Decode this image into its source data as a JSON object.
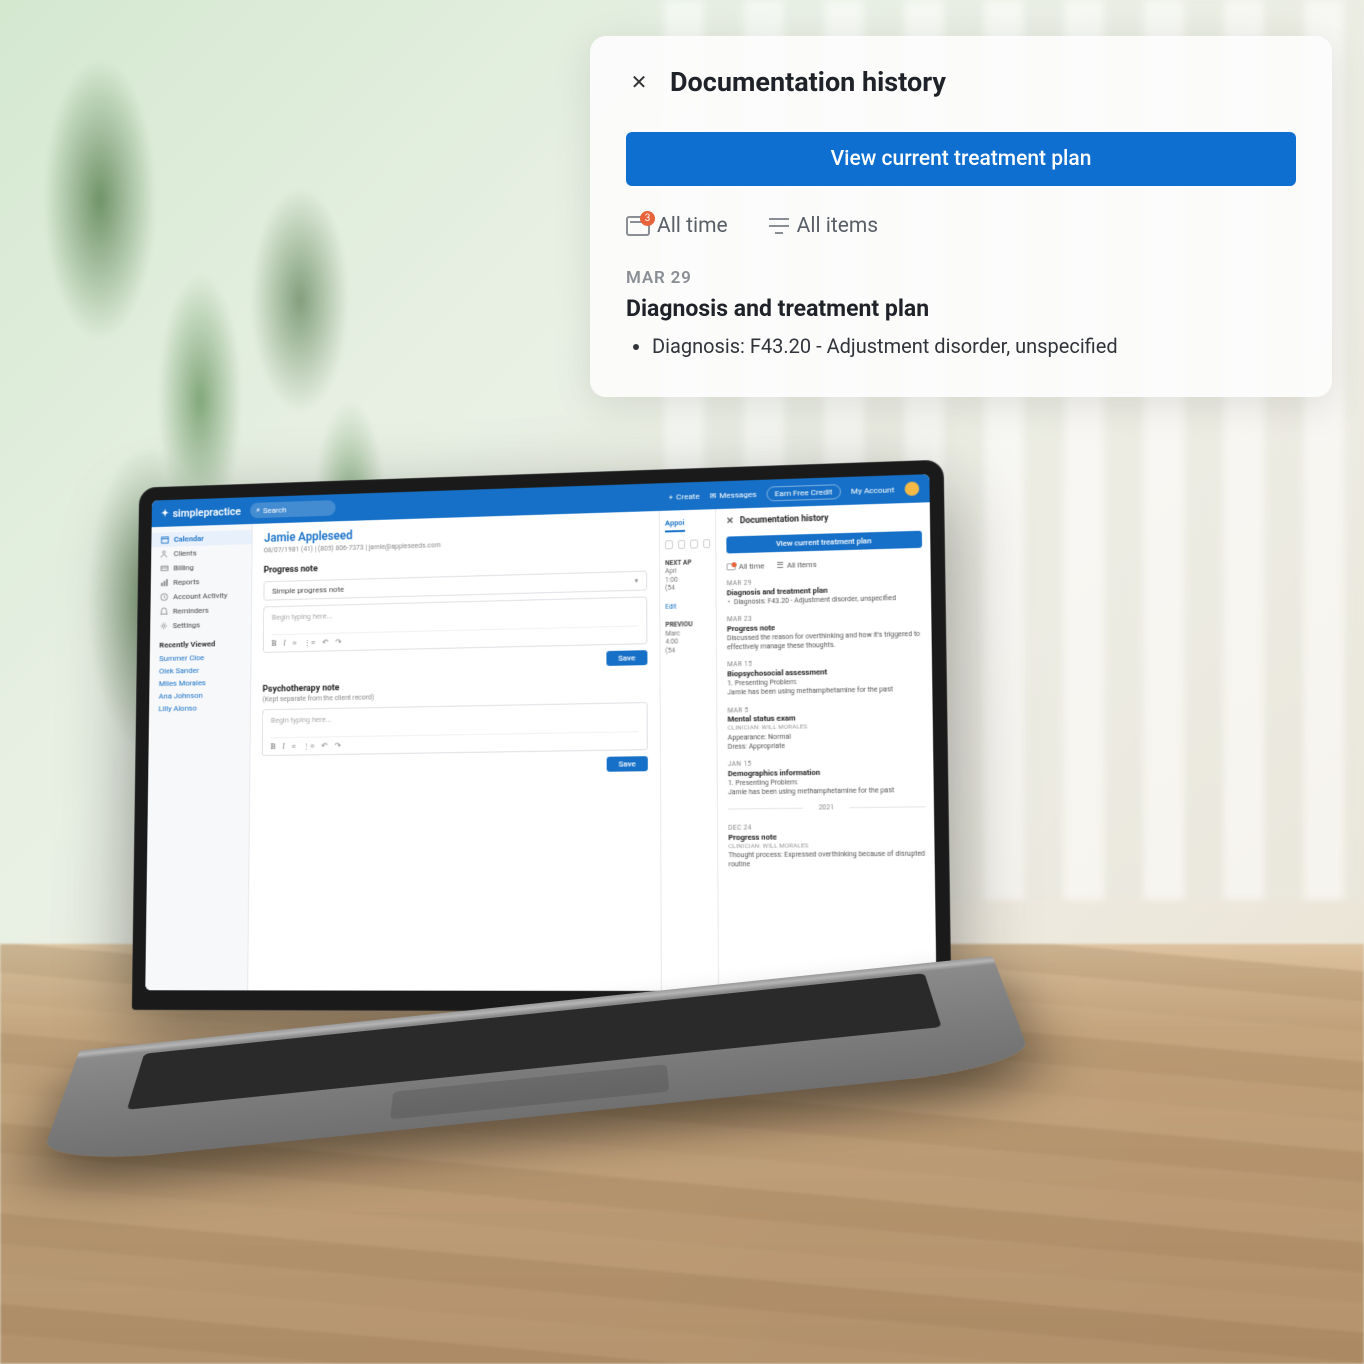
{
  "app": {
    "brand": "simplepractice",
    "search_placeholder": "Search",
    "create": "Create",
    "messages": "Messages",
    "earn_credit": "Earn Free Credit",
    "my_account": "My Account"
  },
  "sidebar": {
    "items": [
      {
        "label": "Calendar",
        "active": true
      },
      {
        "label": "Clients"
      },
      {
        "label": "Billing"
      },
      {
        "label": "Reports"
      },
      {
        "label": "Account Activity"
      },
      {
        "label": "Reminders"
      },
      {
        "label": "Settings"
      }
    ],
    "recent_heading": "Recently Viewed",
    "recent": [
      "Summer Cloe",
      "Olek Sander",
      "Miles Morales",
      "Ana Johnson",
      "Lilly Alonso"
    ]
  },
  "client": {
    "name": "Jamie Appleseed",
    "meta": "08/07/1981 (41) | (805) 806-7373 | jamie@appleseeds.com"
  },
  "progress_note": {
    "title": "Progress note",
    "template_select": "Simple progress note",
    "placeholder": "Begin typing here...",
    "save": "Save"
  },
  "psych_note": {
    "title": "Psychotherapy note",
    "subtitle": "(Kept separate from the client record)",
    "placeholder": "Begin typing here...",
    "save": "Save"
  },
  "strip": {
    "tab": "Appoi",
    "next": {
      "h": "NEXT AP",
      "l1": "Apri",
      "l2": "1:00",
      "l3": "(54"
    },
    "edit": "Edit",
    "prev": {
      "h": "PREVIOU",
      "l1": "Marc",
      "l2": "4:00",
      "l3": "(54"
    }
  },
  "dochistory": {
    "title": "Documentation history",
    "view_btn": "View current treatment plan",
    "filters": {
      "time": "All time",
      "items": "All items"
    },
    "entries": [
      {
        "date": "MAR 29",
        "title": "Diagnosis and treatment plan",
        "bullets": [
          "Diagnosis: F43.20 - Adjustment disorder, unspecified"
        ]
      },
      {
        "date": "MAR 23",
        "title": "Progress note",
        "body": "Discussed the reason for overthinking and how it's triggered to effectively manage these thoughts."
      },
      {
        "date": "MAR 15",
        "title": "Biopsychosocial assessment",
        "body": "1. Presenting Problem:\nJamie has been using methamphetamine for the past"
      },
      {
        "date": "MAR 5",
        "title": "Mental status exam",
        "clin": "CLINICIAN: WILL MORALES",
        "body": "Appearance: Normal\nDress: Appropriate"
      },
      {
        "date": "JAN 15",
        "title": "Demographics information",
        "body": "1. Presenting Problem:\nJamie has been using methamphetamine for the past"
      }
    ],
    "year_divider": "2021",
    "entries2": [
      {
        "date": "DEC 24",
        "title": "Progress note",
        "clin": "CLINICIAN: WILL MORALES",
        "body": "Thought process: Expressed overthinking because of disrupted routine"
      }
    ]
  },
  "floating": {
    "title": "Documentation history",
    "view_btn": "View current treatment plan",
    "filter_time": "All time",
    "filter_items": "All items",
    "entry_date": "MAR 29",
    "entry_title": "Diagnosis and treatment plan",
    "entry_bullet": "Diagnosis: F43.20 - Adjustment disorder, unspecified"
  }
}
